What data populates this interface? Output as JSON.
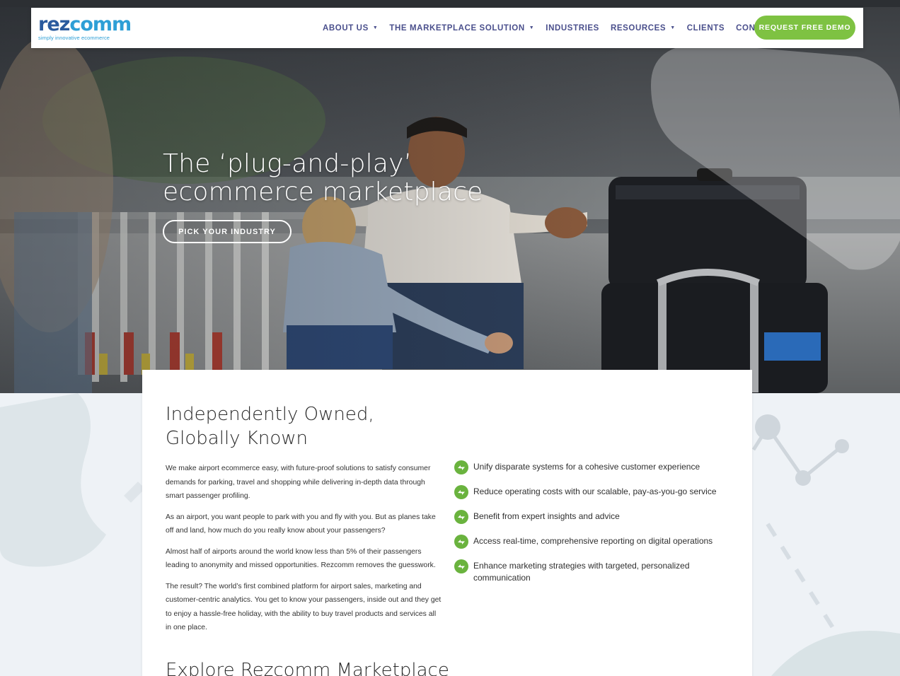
{
  "brand": {
    "logo_main": "rez",
    "logo_z": "comm",
    "tagline": "simply innovative ecommerce"
  },
  "nav": {
    "items": [
      {
        "label": "ABOUT US",
        "dropdown": true
      },
      {
        "label": "THE MARKETPLACE SOLUTION",
        "dropdown": true
      },
      {
        "label": "INDUSTRIES",
        "dropdown": false
      },
      {
        "label": "RESOURCES",
        "dropdown": true
      },
      {
        "label": "CLIENTS",
        "dropdown": false
      },
      {
        "label": "CONTACT US",
        "dropdown": false
      }
    ],
    "cta": "REQUEST FREE DEMO"
  },
  "hero": {
    "title_line1": "The ‘plug-and-play’",
    "title_line2": "ecommerce marketplace",
    "cta": "PICK YOUR INDUSTRY"
  },
  "main": {
    "title_line1": "Independently Owned,",
    "title_line2": "Globally Known",
    "paragraphs": [
      "We make airport ecommerce easy, with future-proof solutions to satisfy consumer demands for parking, travel and shopping while delivering in-depth data through smart passenger profiling.",
      "As an airport, you want people to park with you and fly with you. But as planes take off and land, how much do you really know about your passengers?",
      "Almost half of airports around the world know less than 5% of their passengers leading to anonymity and missed opportunities. Rezcomm removes the guesswork.",
      "The result? The world’s first combined platform for airport sales, marketing and customer-centric analytics. You get to know your passengers, inside out and they get to enjoy a hassle-free holiday, with the ability to buy travel products and services all in one place."
    ],
    "benefits": [
      "Unify disparate systems for a cohesive customer experience",
      "Reduce operating costs with our scalable, pay-as-you-go service",
      "Benefit from expert insights and advice",
      "Access real-time, comprehensive reporting on digital operations",
      "Enhance marketing strategies with targeted, personalized communication"
    ],
    "next_heading": "Explore Rezcomm Marketplace"
  },
  "colors": {
    "brand_blue": "#2a5a9e",
    "brand_light_blue": "#2e9fd6",
    "nav_text": "#4a4f8c",
    "cta_green": "#7ec242",
    "icon_green": "#6ab33e"
  },
  "icons": {
    "benefit": "arrow-check-icon",
    "caret": "caret-down-icon"
  }
}
